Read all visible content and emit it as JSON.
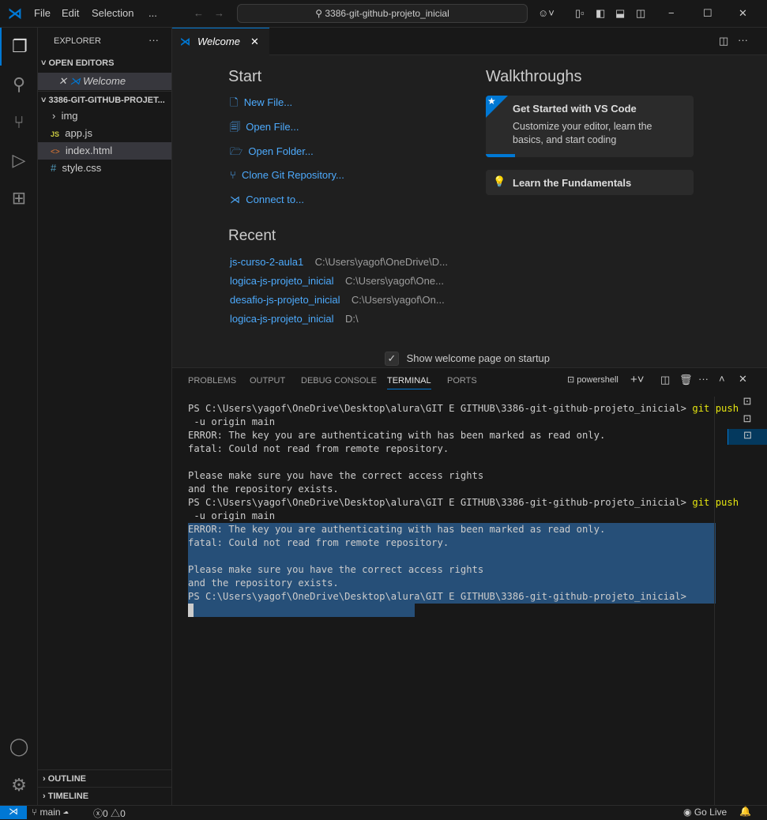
{
  "titlebar": {
    "menus": [
      "File",
      "Edit",
      "Selection",
      "..."
    ],
    "search": "3386-git-github-projeto_inicial"
  },
  "sidebar": {
    "title": "EXPLORER",
    "open_editors": "OPEN EDITORS",
    "open_file": "Welcome",
    "project": "3386-GIT-GITHUB-PROJET...",
    "files": [
      {
        "name": "img",
        "icon": "folder-chevron"
      },
      {
        "name": "app.js",
        "icon": "JS"
      },
      {
        "name": "index.html",
        "icon": "<>"
      },
      {
        "name": "style.css",
        "icon": "#"
      }
    ],
    "outline": "OUTLINE",
    "timeline": "TIMELINE"
  },
  "tab": {
    "label": "Welcome"
  },
  "welcome": {
    "start_title": "Start",
    "start_items": [
      "New File...",
      "Open File...",
      "Open Folder...",
      "Clone Git Repository...",
      "Connect to..."
    ],
    "recent_title": "Recent",
    "recent": [
      {
        "name": "js-curso-2-aula1",
        "path": "C:\\Users\\yagof\\OneDrive\\D..."
      },
      {
        "name": "logica-js-projeto_inicial",
        "path": "C:\\Users\\yagof\\One..."
      },
      {
        "name": "desafio-js-projeto_inicial",
        "path": "C:\\Users\\yagof\\On..."
      },
      {
        "name": "logica-js-projeto_inicial",
        "path": "D:\\"
      }
    ],
    "walk_title": "Walkthroughs",
    "walk1_title": "Get Started with VS Code",
    "walk1_desc1": "Customize your editor, learn the",
    "walk1_desc2": "basics, and start coding",
    "walk2_title": "Learn the Fundamentals",
    "show_startup": "Show welcome page on startup"
  },
  "panel": {
    "tabs": [
      "PROBLEMS",
      "OUTPUT",
      "DEBUG CONSOLE",
      "TERMINAL",
      "PORTS"
    ],
    "active": "TERMINAL",
    "shell": "powershell"
  },
  "terminal": {
    "lines": [
      {
        "text": "PS C:\\Users\\yagof\\OneDrive\\Desktop\\alura\\GIT E GITHUB\\3386-git-github-projeto_inicial> ",
        "cmd": "git push",
        "sel": false
      },
      {
        "text": " -u origin main",
        "cmd": "",
        "sel": false
      },
      {
        "text": "ERROR: The key you are authenticating with has been marked as read only.",
        "cmd": "",
        "sel": false
      },
      {
        "text": "fatal: Could not read from remote repository.",
        "cmd": "",
        "sel": false
      },
      {
        "text": "",
        "cmd": "",
        "sel": false
      },
      {
        "text": "Please make sure you have the correct access rights",
        "cmd": "",
        "sel": false
      },
      {
        "text": "and the repository exists.",
        "cmd": "",
        "sel": false
      },
      {
        "text": "PS C:\\Users\\yagof\\OneDrive\\Desktop\\alura\\GIT E GITHUB\\3386-git-github-projeto_inicial> ",
        "cmd": "git push",
        "sel": false
      },
      {
        "text": " -u origin main",
        "cmd": "",
        "sel": false
      },
      {
        "text": "ERROR: The key you are authenticating with has been marked as read only.",
        "cmd": "",
        "sel": true
      },
      {
        "text": "fatal: Could not read from remote repository.",
        "cmd": "",
        "sel": true
      },
      {
        "text": "",
        "cmd": "",
        "sel": true
      },
      {
        "text": "Please make sure you have the correct access rights",
        "cmd": "",
        "sel": true
      },
      {
        "text": "and the repository exists.",
        "cmd": "",
        "sel": true
      },
      {
        "text": "PS C:\\Users\\yagof\\OneDrive\\Desktop\\alura\\GIT E GITHUB\\3386-git-github-projeto_inicial>",
        "cmd": "",
        "sel": true
      }
    ]
  },
  "status": {
    "branch": "main",
    "errors": "0",
    "warnings": "0",
    "golive": "Go Live"
  },
  "colors": {
    "accent": "#0078d4",
    "link": "#4daafc",
    "selection": "#264f78"
  }
}
